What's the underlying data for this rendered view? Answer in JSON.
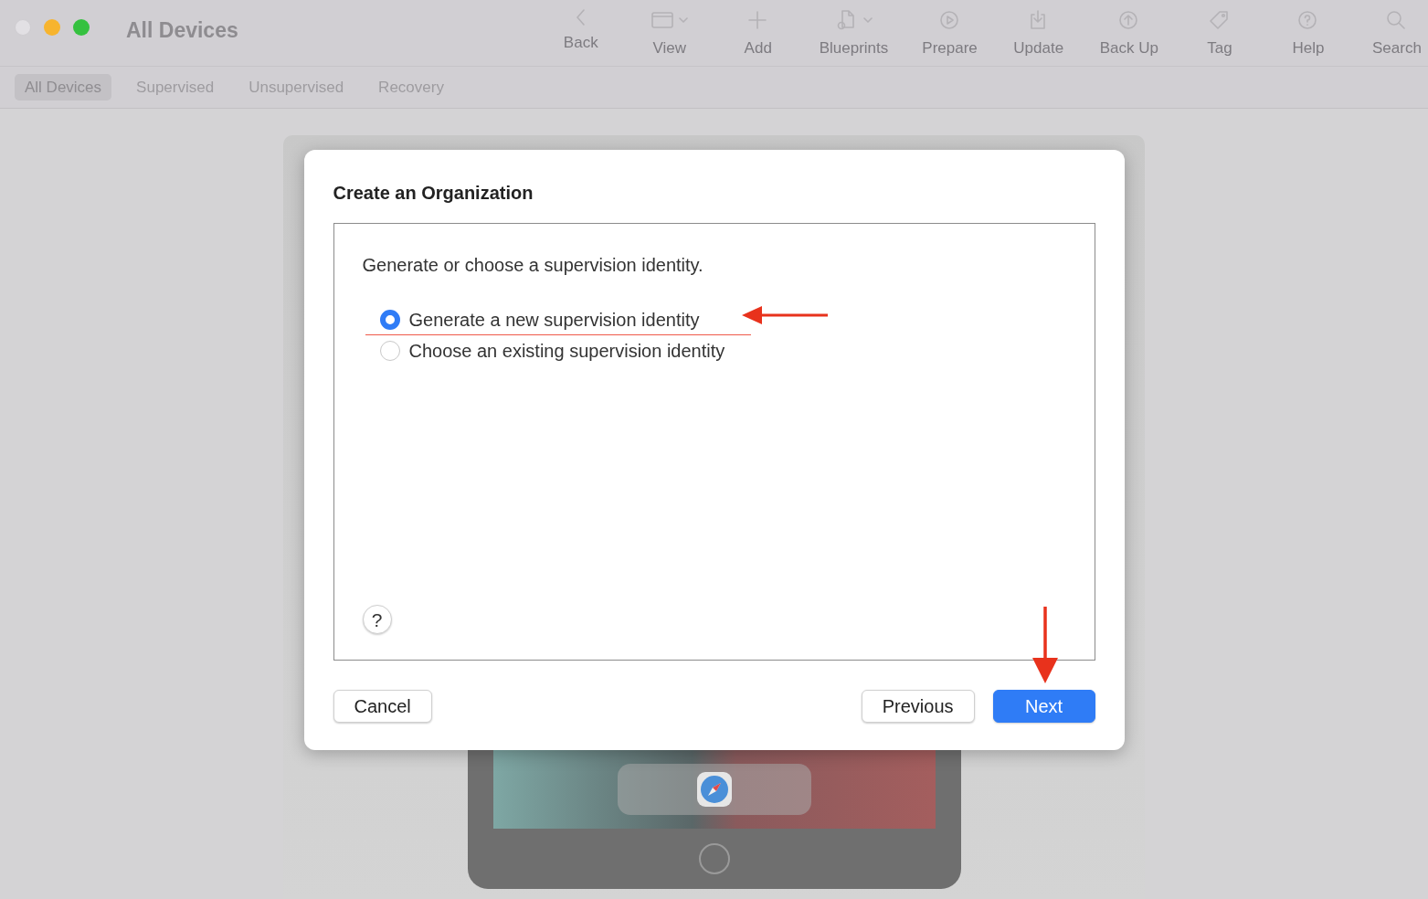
{
  "window": {
    "title": "All Devices"
  },
  "toolbar": [
    {
      "label": "Back",
      "menu": false
    },
    {
      "label": "View",
      "menu": true
    },
    {
      "label": "Add",
      "menu": false
    },
    {
      "label": "Blueprints",
      "menu": true
    },
    {
      "label": "Prepare",
      "menu": false
    },
    {
      "label": "Update",
      "menu": false
    },
    {
      "label": "Back Up",
      "menu": false
    },
    {
      "label": "Tag",
      "menu": false
    },
    {
      "label": "Help",
      "menu": false
    },
    {
      "label": "Search",
      "menu": false
    }
  ],
  "tabs": [
    {
      "label": "All Devices",
      "selected": true
    },
    {
      "label": "Supervised",
      "selected": false
    },
    {
      "label": "Unsupervised",
      "selected": false
    },
    {
      "label": "Recovery",
      "selected": false
    }
  ],
  "dialog": {
    "title": "Create an Organization",
    "prompt": "Generate or choose a supervision identity.",
    "options": [
      {
        "label": "Generate a new supervision identity",
        "selected": true
      },
      {
        "label": "Choose an existing supervision identity",
        "selected": false
      }
    ],
    "help": "?",
    "buttons": [
      {
        "label": "Cancel",
        "kind": "normal"
      },
      {
        "label": "Previous",
        "kind": "normal"
      },
      {
        "label": "Next",
        "kind": "default"
      }
    ]
  }
}
